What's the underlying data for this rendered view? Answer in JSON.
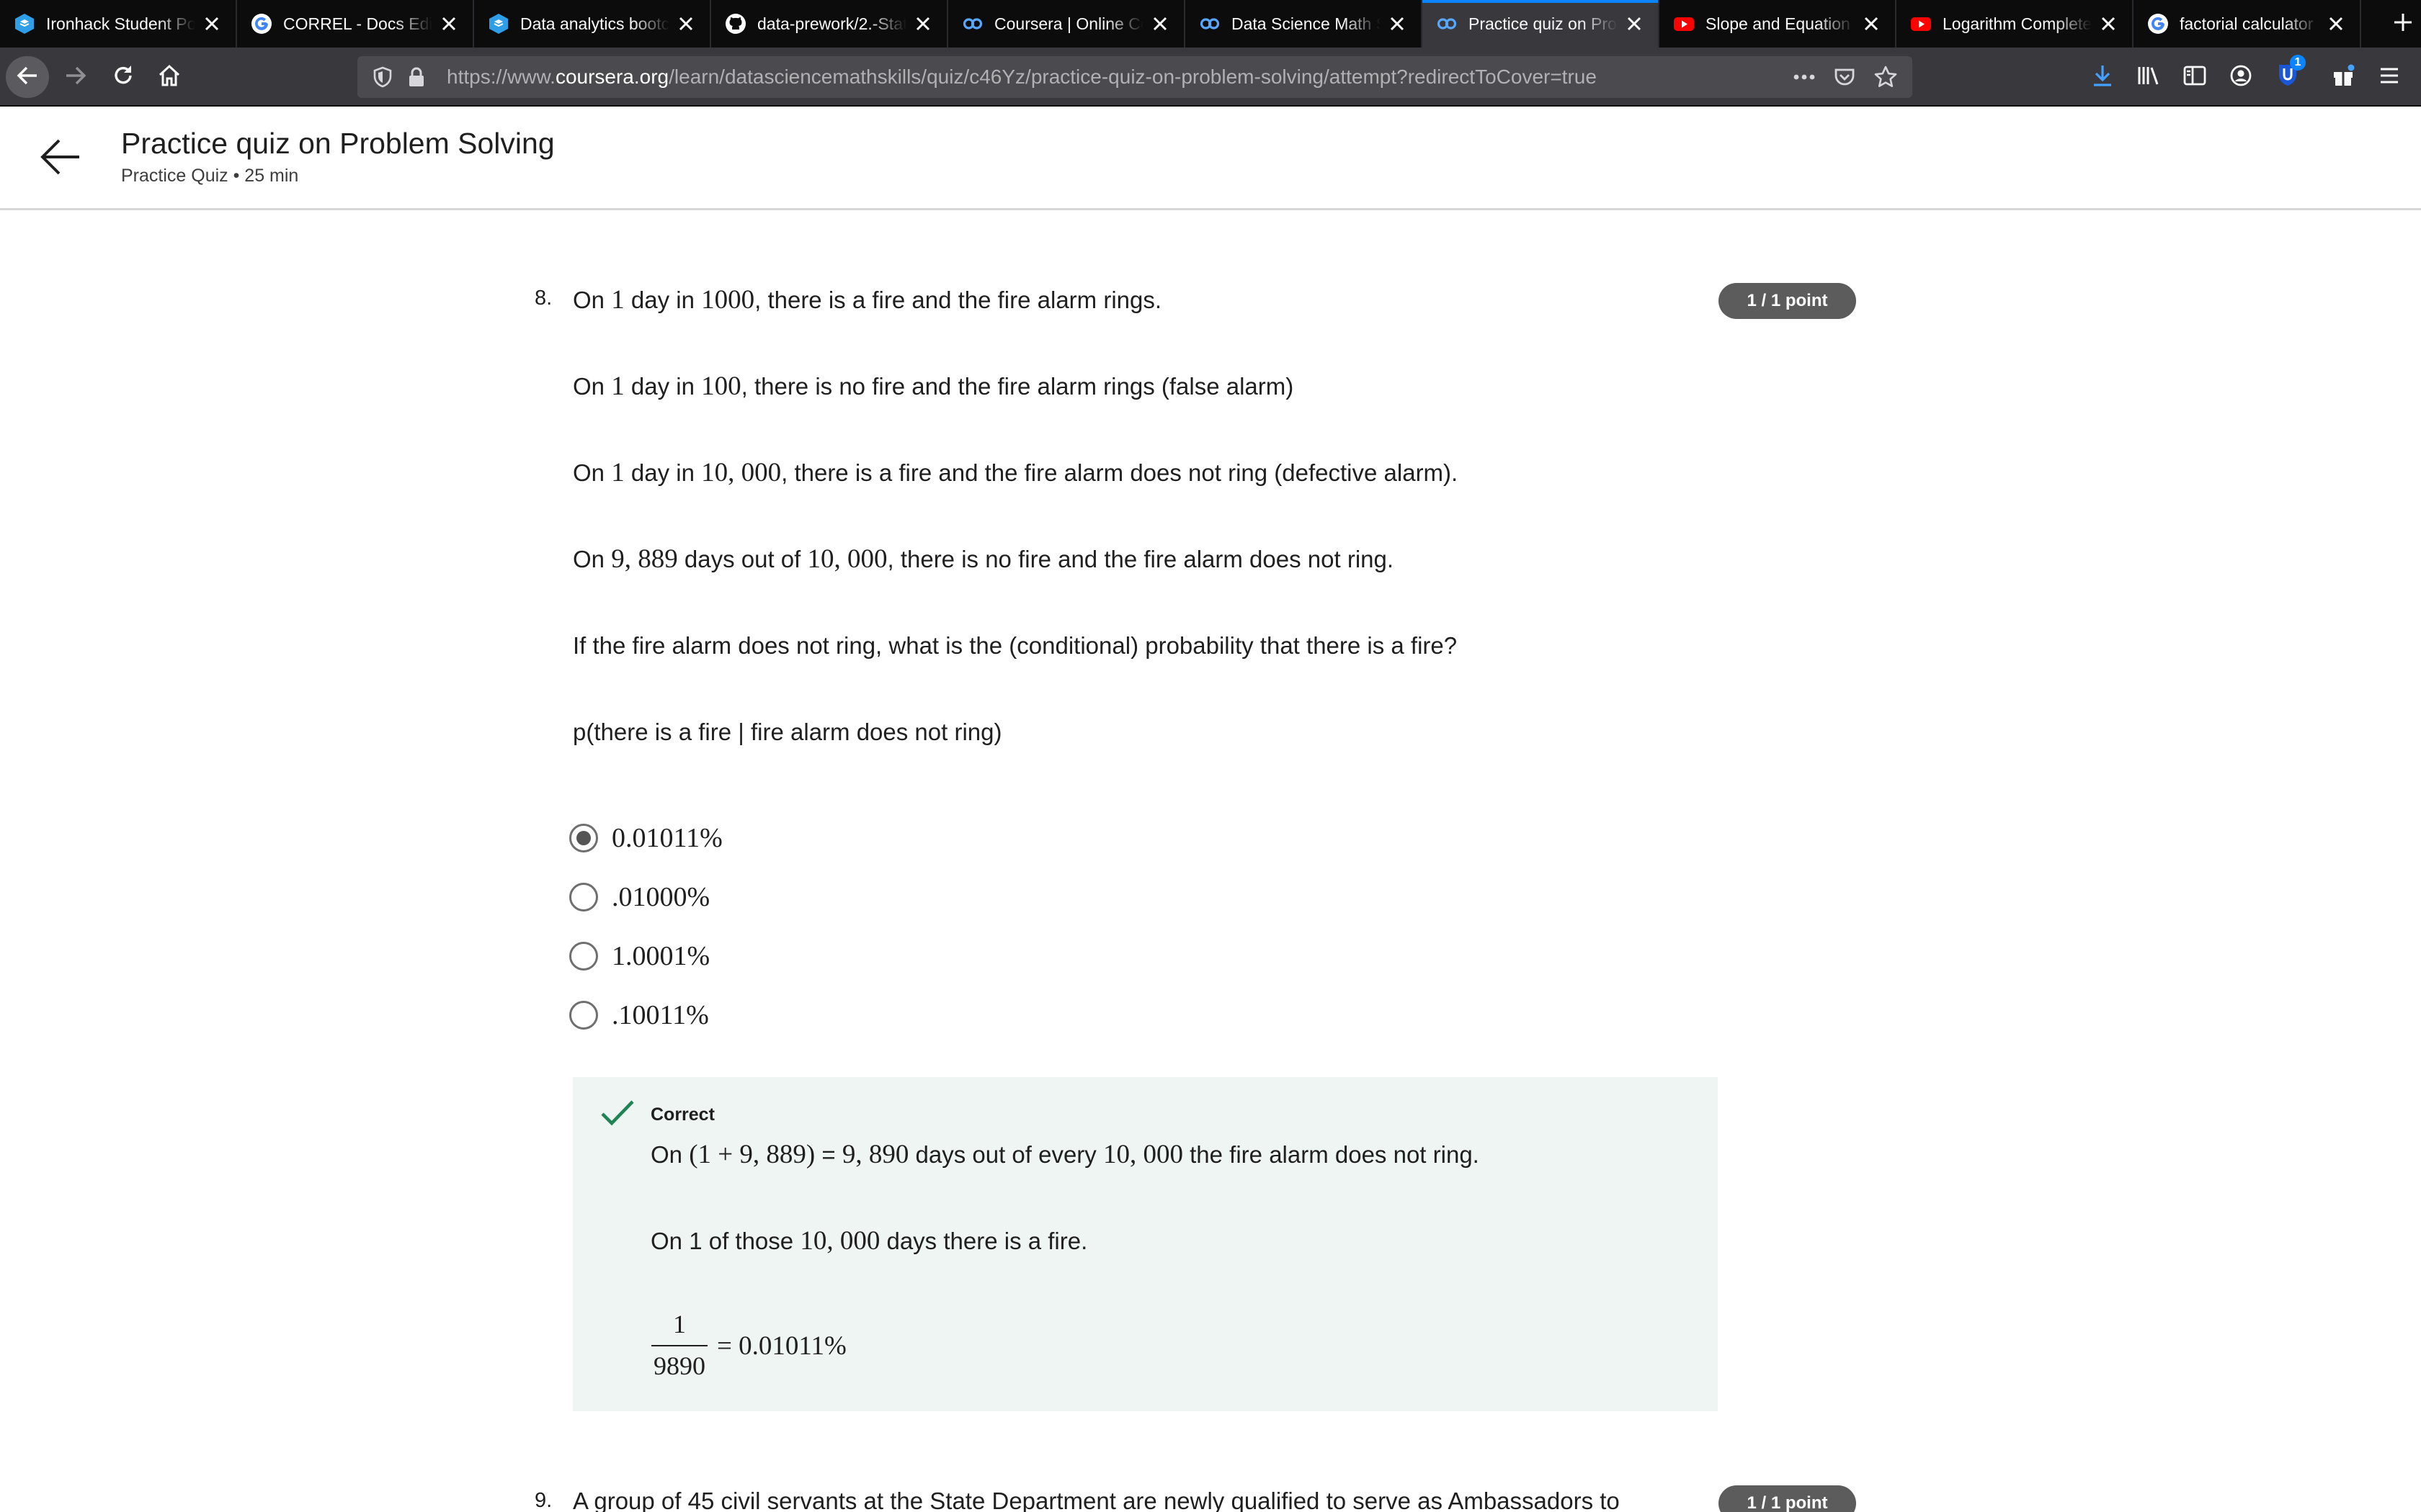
{
  "browser": {
    "tabs": [
      {
        "title": "Ironhack Student Portal",
        "icon": "ironhack-icon",
        "active": false
      },
      {
        "title": "CORREL - Docs Editors Help",
        "icon": "google-icon",
        "active": false
      },
      {
        "title": "Data analytics bootcamp",
        "icon": "ironhack-icon",
        "active": false
      },
      {
        "title": "data-prework/2.-Statistics",
        "icon": "github-icon",
        "active": false
      },
      {
        "title": "Coursera | Online Courses",
        "icon": "coursera-icon",
        "active": false
      },
      {
        "title": "Data Science Math Skills",
        "icon": "coursera-icon",
        "active": false
      },
      {
        "title": "Practice quiz on Problem Solving",
        "icon": "coursera-icon",
        "active": true
      },
      {
        "title": "Slope and Equation of a Line",
        "icon": "youtube-icon",
        "active": false
      },
      {
        "title": "Logarithm Complete Tutorial",
        "icon": "youtube-icon",
        "active": false
      },
      {
        "title": "factorial calculator",
        "icon": "google-icon",
        "active": false
      }
    ],
    "url_prefix": "https://www.",
    "url_domain": "coursera.org",
    "url_path": "/learn/datasciencemathskills/quiz/c46Yz/practice-quiz-on-problem-solving/attempt?redirectToCover=true",
    "extension_badge": "1"
  },
  "header": {
    "title": "Practice quiz on Problem Solving",
    "subtitle": "Practice Quiz • 25 min"
  },
  "question8": {
    "number": "8.",
    "points": "1 / 1 point",
    "lines": [
      {
        "pre": "On ",
        "m1": "1",
        "mid": " day in ",
        "m2": "1000",
        "post": ", there is a fire and the fire alarm rings."
      },
      {
        "pre": "On ",
        "m1": "1",
        "mid": " day in ",
        "m2": "100",
        "post": ", there is no fire and the fire alarm rings (false alarm)"
      },
      {
        "pre": "On ",
        "m1": "1",
        "mid": " day in ",
        "m2": "10, 000",
        "post": ", there is a fire and the fire alarm does not ring (defective alarm)."
      },
      {
        "pre": "On ",
        "m1": "9, 889",
        "mid": " days out of ",
        "m2": "10, 000",
        "post": ", there is no fire and the fire alarm does not ring."
      }
    ],
    "prompt": "If the fire alarm does not ring, what is the (conditional) probability that there is a fire?",
    "notation": "p(there is a fire | fire alarm does not ring)",
    "options": [
      "0.01011%",
      ".01000%",
      "1.0001%",
      ".10011%"
    ],
    "selected_index": 0,
    "feedback": {
      "title": "Correct",
      "line1_pre": "On ",
      "line1_math1": "(1 + 9, 889)",
      "line1_mid": " = ",
      "line1_math2": "9, 890",
      "line1_mid2": " days out of every ",
      "line1_math3": "10, 000",
      "line1_post": " the fire alarm does not ring.",
      "line2_pre": "On 1 of those ",
      "line2_math": "10, 000",
      "line2_post": " days there is a fire.",
      "frac_num": "1",
      "frac_den": "9890",
      "frac_result": "= 0.01011%"
    }
  },
  "question9": {
    "number": "9.",
    "points": "1 / 1 point",
    "text_start": "A group of 45 civil servants at the State Department are newly qualified to serve as Ambassadors to"
  }
}
